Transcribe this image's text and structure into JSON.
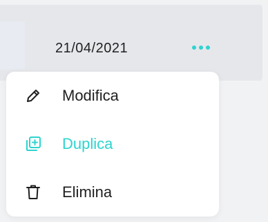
{
  "row": {
    "date": "21/04/2021",
    "more_icon": "more-horizontal-icon"
  },
  "menu": {
    "items": [
      {
        "label": "Modifica",
        "icon": "pencil-icon",
        "color": "#1f1f1f"
      },
      {
        "label": "Duplica",
        "icon": "duplicate-icon",
        "color": "#2dd4cf",
        "active": true
      },
      {
        "label": "Elimina",
        "icon": "trash-icon",
        "color": "#1f1f1f"
      }
    ]
  },
  "colors": {
    "accent": "#2dd4cf",
    "text": "#1f1f1f",
    "background": "#f1f2f4",
    "row_background": "#e6e7eb",
    "menu_background": "#ffffff"
  }
}
